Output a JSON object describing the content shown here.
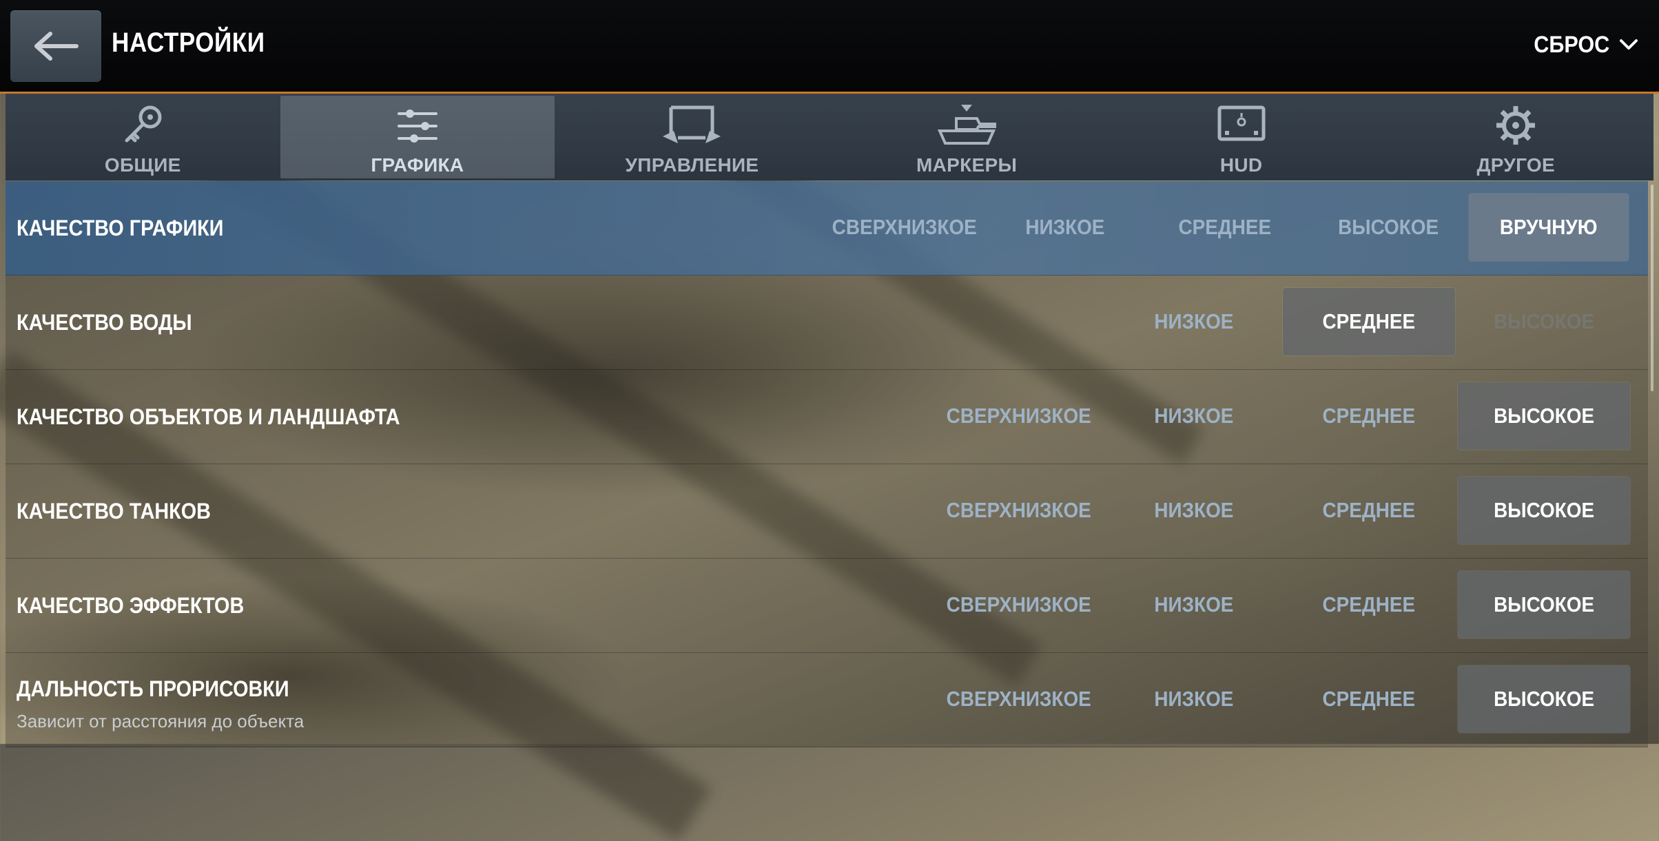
{
  "header": {
    "title": "НАСТРОЙКИ",
    "reset_label": "СБРОС"
  },
  "tabs": [
    {
      "label": "ОБЩИЕ",
      "icon": "key-icon"
    },
    {
      "label": "ГРАФИКА",
      "icon": "sliders-icon",
      "active": true
    },
    {
      "label": "УПРАВЛЕНИЕ",
      "icon": "touch-control-icon"
    },
    {
      "label": "МАРКЕРЫ",
      "icon": "tank-marker-icon"
    },
    {
      "label": "HUD",
      "icon": "hud-icon"
    },
    {
      "label": "ДРУГОЕ",
      "icon": "gear-icon"
    }
  ],
  "settings": [
    {
      "title": "КАЧЕСТВО ГРАФИКИ",
      "options": [
        "СВЕРХНИЗКОЕ",
        "НИЗКОЕ",
        "СРЕДНЕЕ",
        "ВЫСОКОЕ",
        "ВРУЧНУЮ"
      ],
      "selected": "ВРУЧНУЮ"
    },
    {
      "title": "КАЧЕСТВО ВОДЫ",
      "options": [
        "НИЗКОЕ",
        "СРЕДНЕЕ",
        "ВЫСОКОЕ"
      ],
      "selected": "СРЕДНЕЕ",
      "disabled": "ВЫСОКОЕ"
    },
    {
      "title": "КАЧЕСТВО ОБЪЕКТОВ И ЛАНДШАФТА",
      "options": [
        "СВЕРХНИЗКОЕ",
        "НИЗКОЕ",
        "СРЕДНЕЕ",
        "ВЫСОКОЕ"
      ],
      "selected": "ВЫСОКОЕ"
    },
    {
      "title": "КАЧЕСТВО ТАНКОВ",
      "options": [
        "СВЕРХНИЗКОЕ",
        "НИЗКОЕ",
        "СРЕДНЕЕ",
        "ВЫСОКОЕ"
      ],
      "selected": "ВЫСОКОЕ"
    },
    {
      "title": "КАЧЕСТВО ЭФФЕКТОВ",
      "options": [
        "СВЕРХНИЗКОЕ",
        "НИЗКОЕ",
        "СРЕДНЕЕ",
        "ВЫСОКОЕ"
      ],
      "selected": "ВЫСОКОЕ"
    },
    {
      "title": "ДАЛЬНОСТЬ ПРОРИСОВКИ",
      "subtitle": "Зависит от расстояния до объекта",
      "options": [
        "СВЕРХНИЗКОЕ",
        "НИЗКОЕ",
        "СРЕДНЕЕ",
        "ВЫСОКОЕ"
      ],
      "selected": "ВЫСОКОЕ"
    }
  ],
  "colors": {
    "accent_line": "#c9782a",
    "option_text": "#9db2c6",
    "highlight_row": "#3f6c93"
  }
}
